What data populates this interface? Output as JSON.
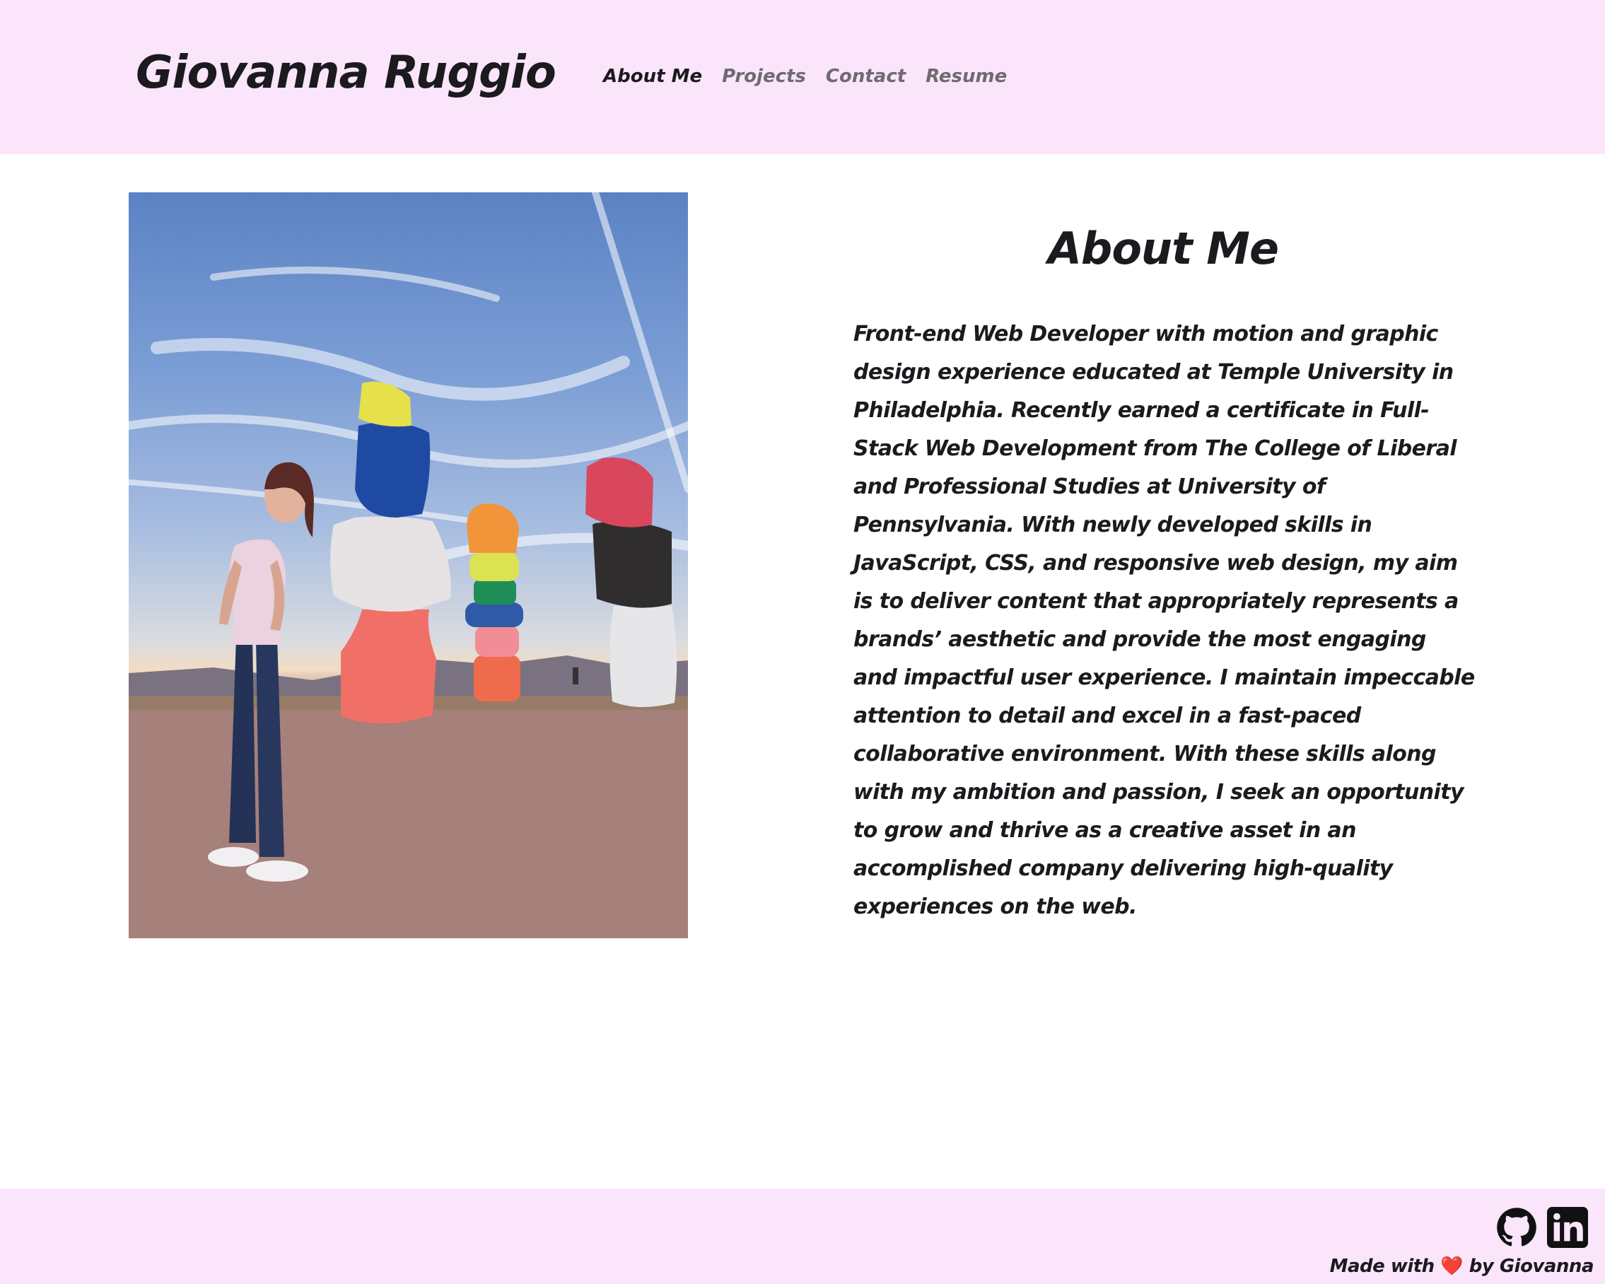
{
  "header": {
    "brand": "Giovanna Ruggio",
    "nav": [
      {
        "label": "About Me",
        "active": true
      },
      {
        "label": "Projects",
        "active": false
      },
      {
        "label": "Contact",
        "active": false
      },
      {
        "label": "Resume",
        "active": false
      }
    ]
  },
  "main": {
    "title": "About Me",
    "bio": "Front-end Web Developer with motion and graphic design experience educated at Temple University in Philadelphia. Recently earned a certificate in Full-Stack Web Development from The College of Liberal and Professional Studies at University of Pennsylvania. With newly developed skills in JavaScript, CSS, and responsive web design, my aim is to deliver content that appropriately represents a brands’ aesthetic and provide the most engaging and impactful user experience. I maintain impeccable attention to detail and excel in a fast-paced collaborative environment. With these skills along with my ambition and passion, I seek an opportunity to grow and thrive as a creative asset in an accomplished company delivering high-quality experiences on the web."
  },
  "footer": {
    "social_icons": [
      "github-icon",
      "linkedin-icon"
    ],
    "credit_prefix": "Made with",
    "credit_heart": "❤️",
    "credit_suffix": "by Giovanna"
  },
  "colors": {
    "header_bg": "#fae5fa",
    "text": "#1b1a1e",
    "nav_inactive": "#6e6a70"
  }
}
